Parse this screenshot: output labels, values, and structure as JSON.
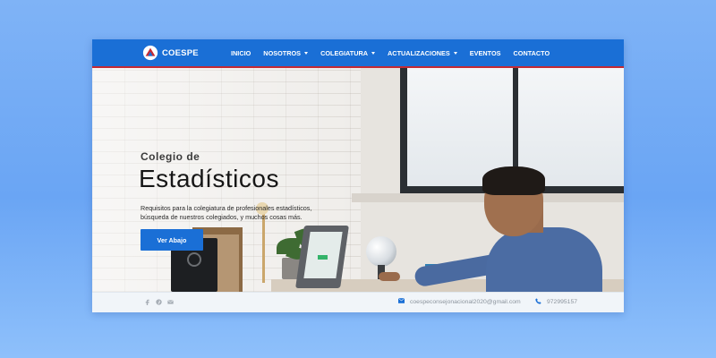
{
  "brand": {
    "name": "COESPE"
  },
  "nav": {
    "items": [
      {
        "label": "INICIO",
        "dropdown": false
      },
      {
        "label": "NOSOTROS",
        "dropdown": true
      },
      {
        "label": "COLEGIATURA",
        "dropdown": true
      },
      {
        "label": "ACTUALIZACIONES",
        "dropdown": true
      },
      {
        "label": "EVENTOS",
        "dropdown": false
      },
      {
        "label": "CONTACTO",
        "dropdown": false
      }
    ]
  },
  "hero": {
    "kicker": "Colegio de",
    "title": "Estadísticos",
    "description_line1": "Requisitos para la colegiatura de profesionales estadísticos,",
    "description_line2": "búsqueda de nuestros colegiados, y muchos cosas más.",
    "button_label": "Ver Abajo"
  },
  "footer": {
    "social_icons": [
      "facebook-icon",
      "pinterest-icon",
      "mail-icon"
    ],
    "email": "coespeconsejonacional2020@gmail.com",
    "phone": "972995157"
  },
  "colors": {
    "primary": "#1a6fd6",
    "accent_line": "#c42a34",
    "page_background": "#7fb3f6"
  }
}
